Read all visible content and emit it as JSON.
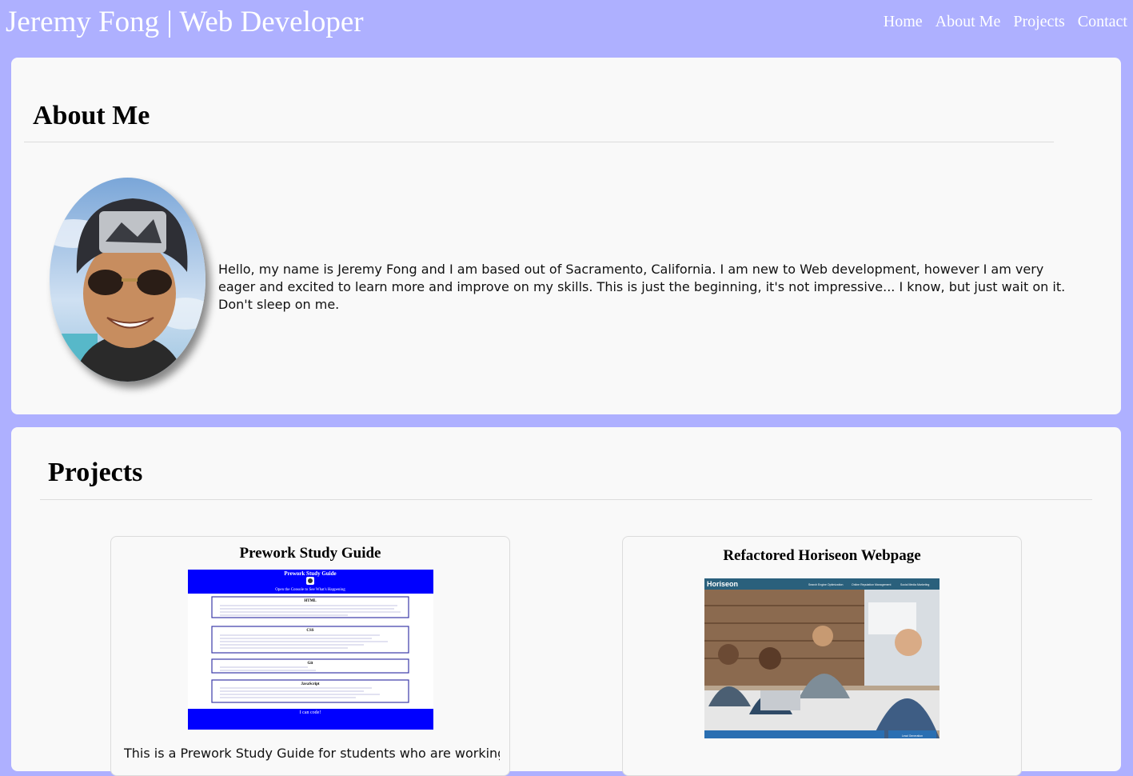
{
  "header": {
    "title": "Jeremy Fong | Web Developer",
    "nav": [
      "Home",
      "About Me",
      "Projects",
      "Contact"
    ]
  },
  "about": {
    "heading": "About Me",
    "avatar_icon": "profile-photo",
    "bio": "Hello, my name is Jeremy Fong and I am based out of Sacramento, California. I am new to Web development, however I am very eager and excited to learn more and improve on my skills. This is just the beginning, it's not impressive... I know, but just wait on it. Don't sleep on me."
  },
  "projects": {
    "heading": "Projects",
    "items": [
      {
        "title": "Prework Study Guide",
        "description": "This is a Prework Study Guide for students who are working",
        "thumb": {
          "title": "Prework Study Guide",
          "subtitle": "Open the Console to See What's Happening",
          "sections": [
            "HTML",
            "CSS",
            "Git",
            "JavaScript"
          ],
          "footer": "I can code!"
        }
      },
      {
        "title": "Refactored Horiseon Webpage",
        "description": "",
        "thumb": {
          "brand": "Horiseon",
          "nav": [
            "Search Engine Optimization",
            "Online Reputation Management",
            "Social Media Marketing"
          ],
          "cta": "Lead Generation"
        }
      }
    ]
  },
  "colors": {
    "page_bg": "#aeb0ff",
    "card_bg": "#f9f9f9",
    "thumb_blue": "#0000ff",
    "horiseon_teal": "#2a607c"
  }
}
